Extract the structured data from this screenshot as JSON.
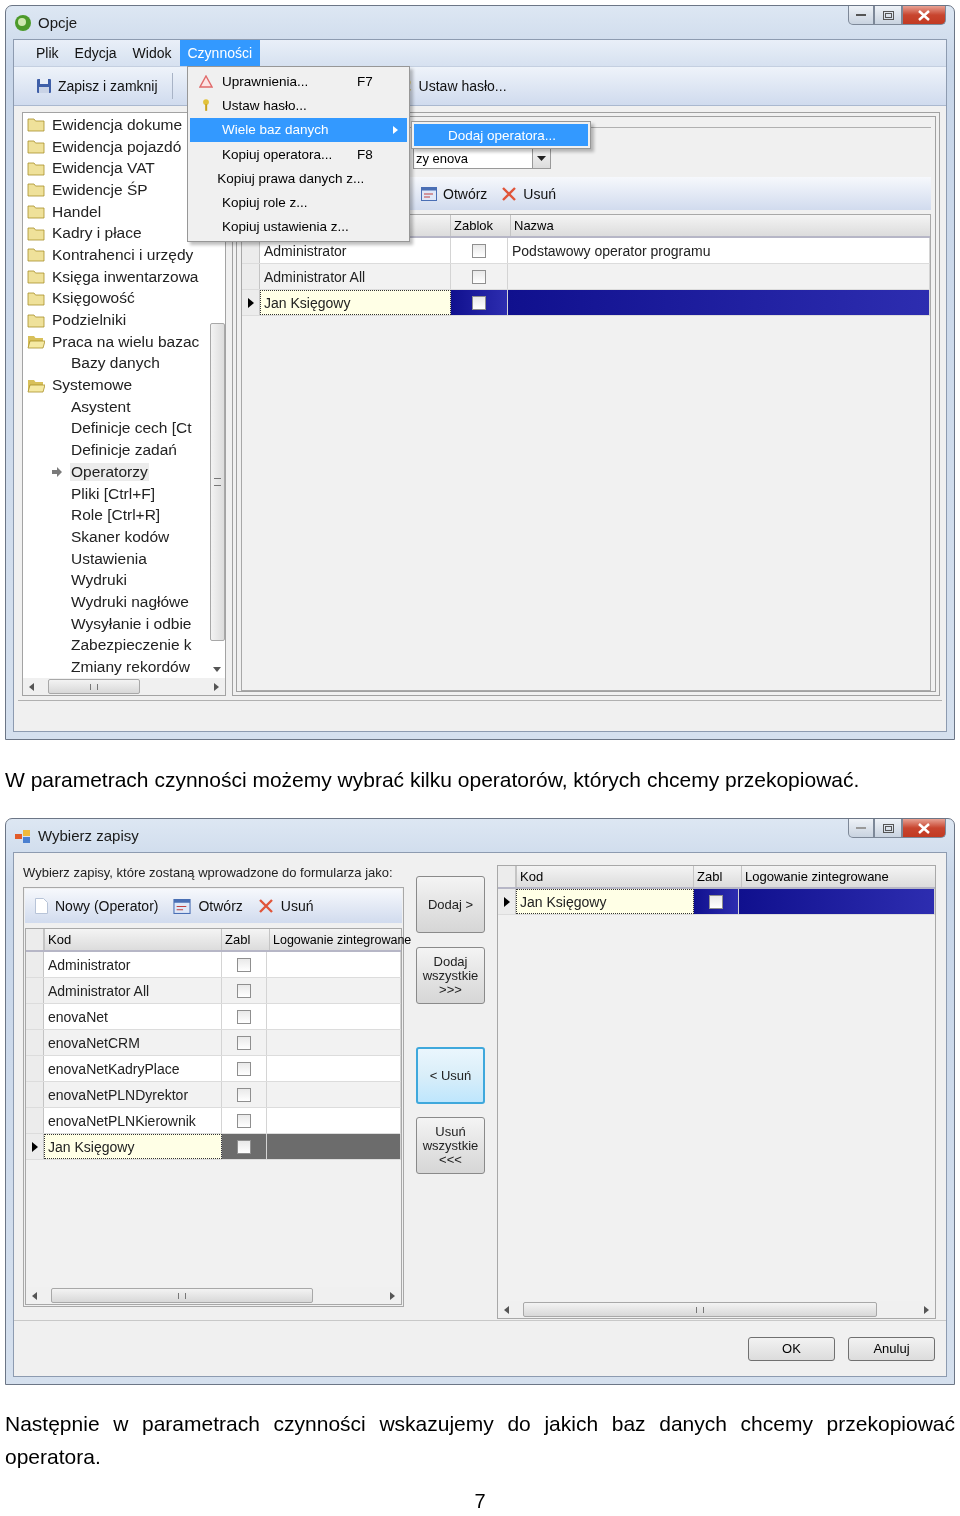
{
  "window_1": {
    "title": "Opcje",
    "menu": [
      {
        "label": "Plik",
        "selected": false
      },
      {
        "label": "Edycja",
        "selected": false
      },
      {
        "label": "Widok",
        "selected": false
      },
      {
        "label": "Czynności",
        "selected": true
      }
    ],
    "toolbar": [
      {
        "label": "Zapisz i zamknij",
        "kind": "save"
      },
      {
        "label": "Ustaw hasło...",
        "kind": "key"
      }
    ],
    "tree": [
      {
        "label": "Ewidencja dokume",
        "expanded": false,
        "selected": false
      },
      {
        "label": "Ewidencja pojazdó",
        "expanded": false,
        "selected": false
      },
      {
        "label": "Ewidencja VAT",
        "expanded": false,
        "selected": false
      },
      {
        "label": "Ewidencje ŚP",
        "expanded": false,
        "selected": false
      },
      {
        "label": "Handel",
        "expanded": false,
        "selected": false
      },
      {
        "label": "Kadry i płace",
        "expanded": false,
        "selected": false
      },
      {
        "label": "Kontrahenci i urzędy",
        "expanded": false,
        "selected": false
      },
      {
        "label": "Księga inwentarzowa",
        "expanded": false,
        "selected": false
      },
      {
        "label": "Księgowość",
        "expanded": false,
        "selected": false
      },
      {
        "label": "Podzielniki",
        "expanded": false,
        "selected": false
      },
      {
        "label": "Praca na wielu bazac",
        "expanded": true,
        "selected": false,
        "children": [
          {
            "label": "Bazy danych",
            "selected": false
          }
        ]
      },
      {
        "label": "Systemowe",
        "expanded": true,
        "selected": false,
        "children": [
          {
            "label": "Asystent",
            "selected": false
          },
          {
            "label": "Definicje cech [Ct",
            "selected": false
          },
          {
            "label": "Definicje zadań",
            "selected": false
          },
          {
            "label": "Operatorzy",
            "selected": true
          },
          {
            "label": "Pliki [Ctrl+F]",
            "selected": false
          },
          {
            "label": "Role [Ctrl+R]",
            "selected": false
          },
          {
            "label": "Skaner kodów",
            "selected": false
          },
          {
            "label": "Ustawienia",
            "selected": false
          },
          {
            "label": "Wydruki",
            "selected": false
          },
          {
            "label": "Wydruki nagłówe",
            "selected": false
          },
          {
            "label": "Wysyłanie i odbie",
            "selected": false
          },
          {
            "label": "Zabezpieczenie k",
            "selected": false
          },
          {
            "label": "Zmiany rekordów",
            "selected": false
          }
        ]
      }
    ],
    "combo": {
      "value": "zy enova"
    },
    "grid_toolbar": [
      {
        "label": "Otwórz",
        "kind": "open"
      },
      {
        "label": "Usuń",
        "kind": "delete"
      }
    ],
    "grid": {
      "columns": [
        "Zablok",
        "Nazwa"
      ],
      "rows": [
        {
          "kod": "Administrator",
          "blocked": false,
          "nazwa": "Podstawowy operator programu",
          "selected": false
        },
        {
          "kod": "Administrator All",
          "blocked": false,
          "selected": false
        },
        {
          "kod": "Jan Księgowy",
          "blocked": false,
          "selected": true
        }
      ]
    },
    "dropdown": [
      {
        "label": "Uprawnienia...",
        "shortcut": "F7",
        "kind": "warning",
        "selected": false
      },
      {
        "label": "Ustaw hasło...",
        "kind": "key",
        "selected": false
      },
      {
        "label": "Wiele baz danych",
        "kind": "submenu",
        "selected": true
      },
      {
        "label": "Kopiuj operatora...",
        "shortcut": "F8",
        "kind": "plain",
        "selected": false
      },
      {
        "label": "Kopiuj prawa danych z...",
        "kind": "plain",
        "selected": false
      },
      {
        "label": "Kopiuj role z...",
        "kind": "plain",
        "selected": false
      },
      {
        "label": "Kopiuj ustawienia z...",
        "kind": "plain",
        "selected": false
      }
    ],
    "submenu": [
      {
        "label": "Dodaj operatora...",
        "selected": true
      }
    ]
  },
  "caption_1": "W parametrach czynności możemy wybrać kilku operatorów, których chcemy przekopiować.",
  "window_2": {
    "title": "Wybierz zapisy",
    "instruction": "Wybierz zapisy, które zostaną wprowadzone do formularza jako:",
    "toolbar": [
      {
        "label": "Nowy (Operator)",
        "kind": "new"
      },
      {
        "label": "Otwórz",
        "kind": "open"
      },
      {
        "label": "Usuń",
        "kind": "delete"
      }
    ],
    "source_grid": {
      "focused": false,
      "columns": [
        "Kod",
        "Zabl",
        "Logowanie zintegrowane"
      ],
      "rows": [
        {
          "kod": "Administrator",
          "blocked": false,
          "selected": false
        },
        {
          "kod": "Administrator All",
          "blocked": false,
          "selected": false
        },
        {
          "kod": "enovaNet",
          "blocked": false,
          "selected": false
        },
        {
          "kod": "enovaNetCRM",
          "blocked": false,
          "selected": false
        },
        {
          "kod": "enovaNetKadryPlace",
          "blocked": false,
          "selected": false
        },
        {
          "kod": "enovaNetPLNDyrektor",
          "blocked": false,
          "selected": false
        },
        {
          "kod": "enovaNetPLNKierownik",
          "blocked": false,
          "selected": false
        },
        {
          "kod": "Jan Księgowy",
          "blocked": false,
          "selected": true
        }
      ]
    },
    "transfer_buttons": [
      {
        "label": "Dodaj >",
        "focused": false
      },
      {
        "label": "Dodaj wszystkie >>>",
        "focused": false
      },
      {
        "label": "< Usuń",
        "focused": true
      },
      {
        "label": "Usuń wszystkie <<<",
        "focused": false
      }
    ],
    "target_grid": {
      "focused": true,
      "columns": [
        "Kod",
        "Zabl",
        "Logowanie zintegrowane"
      ],
      "rows": [
        {
          "kod": "Jan Księgowy",
          "blocked": false,
          "selected": true
        }
      ]
    },
    "buttons": [
      "OK",
      "Anuluj"
    ]
  },
  "caption_2": "Następnie w parametrach czynności wskazujemy do jakich baz danych chcemy przekopiować operatora.",
  "page_number": "7"
}
